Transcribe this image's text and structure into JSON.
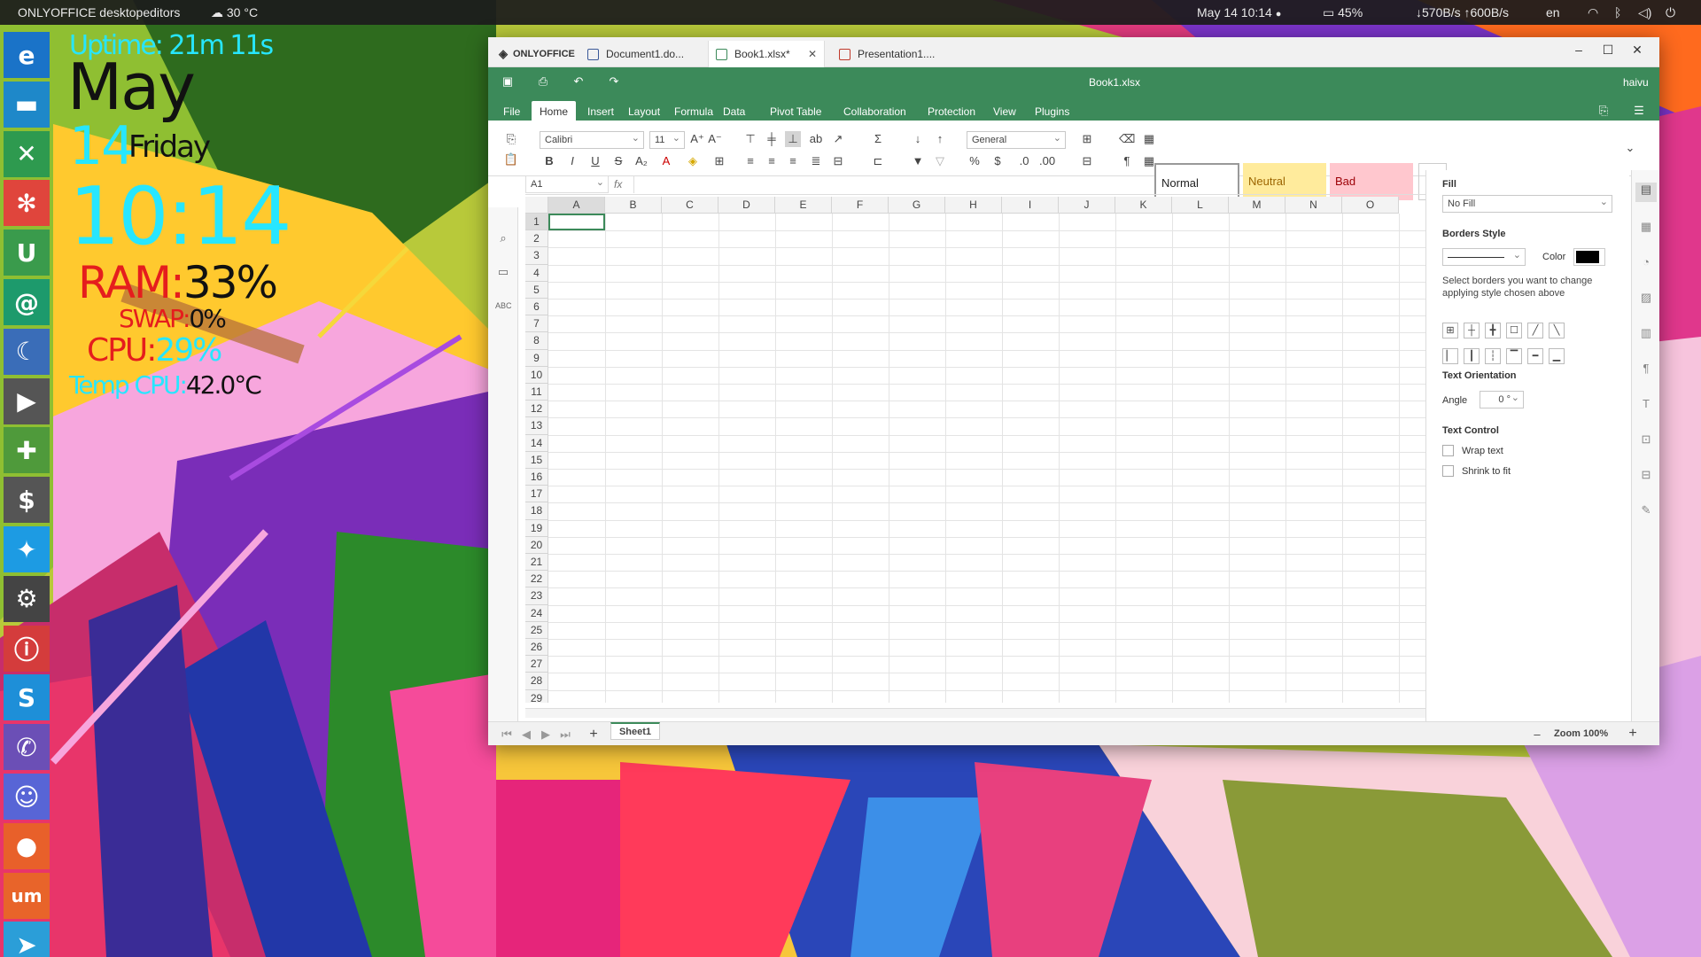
{
  "topbar": {
    "app_name": "ONLYOFFICE desktopeditors",
    "weather": "30 °C",
    "datetime": "May 14  10:14",
    "dot": "●",
    "battery": "45%",
    "network": "↓570B/s ↑600B/s",
    "lang": "en"
  },
  "conky": {
    "uptime": "Uptime: 21m 11s",
    "month": "May",
    "day": "14",
    "weekday": "Friday",
    "time": "10:14",
    "ram_label": "RAM:",
    "ram_value": "33%",
    "swap_label": "SWAP:",
    "swap_value": "0%",
    "cpu_label": "CPU:",
    "cpu_value": "29%",
    "temp_label": "Temp CPU:",
    "temp_value": "42.0°C"
  },
  "dock": [
    {
      "name": "edge",
      "glyph": "e",
      "color": "#1a73c8"
    },
    {
      "name": "files",
      "glyph": "▬",
      "color": "#1e88c9"
    },
    {
      "name": "crossover",
      "glyph": "✕",
      "color": "#2e9a4f"
    },
    {
      "name": "photos",
      "glyph": "✻",
      "color": "#e0453c"
    },
    {
      "name": "upwork",
      "glyph": "U",
      "color": "#3a9b4c"
    },
    {
      "name": "mail",
      "glyph": "@",
      "color": "#1d9a6c"
    },
    {
      "name": "browser",
      "glyph": "☾",
      "color": "#3a6db8"
    },
    {
      "name": "media",
      "glyph": "▶",
      "color": "#555"
    },
    {
      "name": "games",
      "glyph": "✚",
      "color": "#4f9a3b"
    },
    {
      "name": "terminal",
      "glyph": "$",
      "color": "#555"
    },
    {
      "name": "twitter",
      "glyph": "✦",
      "color": "#1d9be3"
    },
    {
      "name": "steam",
      "glyph": "⚙",
      "color": "#444"
    },
    {
      "name": "podcast",
      "glyph": "ⓘ",
      "color": "#d43c3c"
    },
    {
      "name": "skype",
      "glyph": "S",
      "color": "#1e8fd8"
    },
    {
      "name": "phone",
      "glyph": "✆",
      "color": "#6b4fb6"
    },
    {
      "name": "discord",
      "glyph": "☺",
      "color": "#5865d6"
    },
    {
      "name": "reddit",
      "glyph": "●",
      "color": "#e8602a"
    },
    {
      "name": "ubuntu-make",
      "glyph": "um",
      "color": "#e8642a"
    },
    {
      "name": "telegram",
      "glyph": "➤",
      "color": "#2b9ed8"
    }
  ],
  "window": {
    "tabs": [
      {
        "label": "ONLYOFFICE",
        "type": "logo"
      },
      {
        "label": "Document1.do...",
        "type": "doc"
      },
      {
        "label": "Book1.xlsx*",
        "type": "sheet"
      },
      {
        "label": "Presentation1....",
        "type": "pres"
      }
    ],
    "file_title": "Book1.xlsx",
    "user": "haivu",
    "menu": [
      "File",
      "Home",
      "Insert",
      "Layout",
      "Formula",
      "Data",
      "Pivot Table",
      "Collaboration",
      "Protection",
      "View",
      "Plugins"
    ],
    "active_menu": "Home",
    "font_name": "Calibri",
    "font_size": "11",
    "number_format": "General",
    "styles": [
      {
        "label": "Normal",
        "bg": "#ffffff",
        "fg": "#222222"
      },
      {
        "label": "Neutral",
        "bg": "#ffeb9c",
        "fg": "#9c6500"
      },
      {
        "label": "Bad",
        "bg": "#ffc7ce",
        "fg": "#9c0006"
      }
    ],
    "cell_ref": "A1",
    "fx": "fx",
    "columns": [
      "A",
      "B",
      "C",
      "D",
      "E",
      "F",
      "G",
      "H",
      "I",
      "J",
      "K",
      "L",
      "M",
      "N",
      "O"
    ],
    "rows": [
      "1",
      "2",
      "3",
      "4",
      "5",
      "6",
      "7",
      "8",
      "9",
      "10",
      "11",
      "12",
      "13",
      "14",
      "15",
      "16",
      "17",
      "18",
      "19",
      "20",
      "21",
      "22",
      "23",
      "24",
      "25",
      "26",
      "27",
      "28",
      "29"
    ],
    "sheet_tab": "Sheet1",
    "zoom": "Zoom 100%",
    "panel": {
      "fill_title": "Fill",
      "fill_value": "No Fill",
      "borders_title": "Borders Style",
      "color_label": "Color",
      "borders_hint": "Select borders you want to change applying style chosen above",
      "orientation_title": "Text Orientation",
      "angle_label": "Angle",
      "angle_value": "0 °",
      "control_title": "Text Control",
      "wrap_text": "Wrap text",
      "shrink_to_fit": "Shrink to fit"
    }
  }
}
